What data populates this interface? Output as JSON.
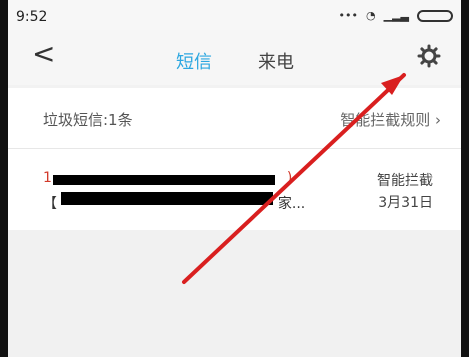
{
  "status": {
    "time": "9:52",
    "icons": [
      "dots-icon",
      "wifi-icon",
      "signal-icon",
      "battery-icon"
    ]
  },
  "nav": {
    "back_icon": "back-icon",
    "tab_sms": "短信",
    "tab_call": "来电",
    "settings_icon": "gear-icon"
  },
  "list": {
    "spam_label": "垃圾短信:1条",
    "rule_label": "智能拦截规则",
    "message": {
      "sender_visible": "1",
      "sender_end": ")",
      "snippet_prefix": "【",
      "snippet_suffix": "家...",
      "tag": "智能拦截",
      "date": "3月31日"
    }
  },
  "colors": {
    "accent": "#2ca7e0",
    "arrow": "#d91f1f"
  }
}
